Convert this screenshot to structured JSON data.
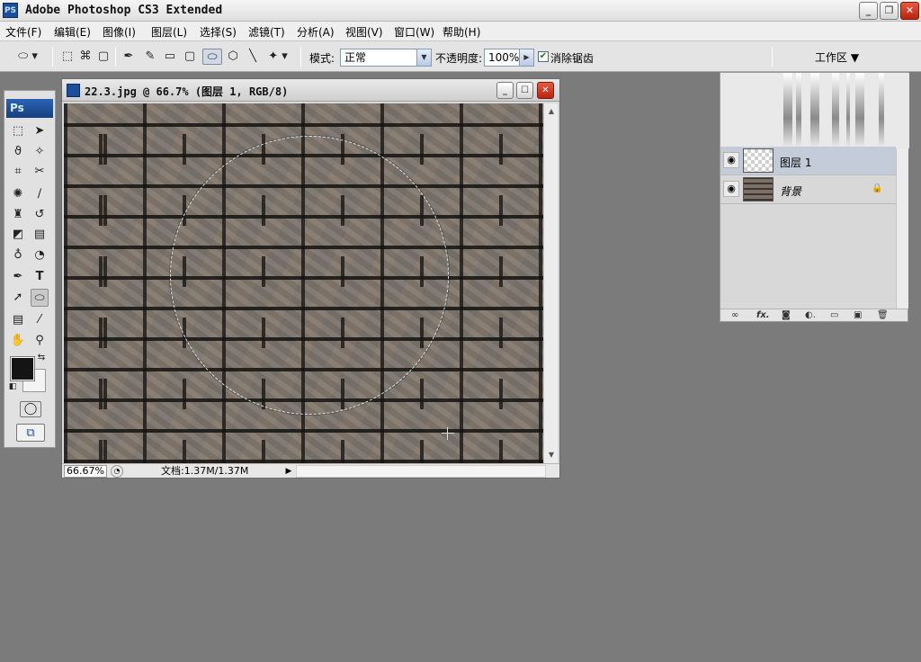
{
  "titlebar": {
    "app_icon": "PS",
    "title": "Adobe Photoshop CS3 Extended",
    "minimize": "_",
    "restore": "❐",
    "close": "✕"
  },
  "menubar": {
    "items": [
      "文件(F)",
      "编辑(E)",
      "图像(I)",
      "图层(L)",
      "选择(S)",
      "滤镜(T)",
      "分析(A)",
      "视图(V)",
      "窗口(W)",
      "帮助(H)"
    ]
  },
  "options": {
    "mode_label": "模式:",
    "mode_value": "正常",
    "opacity_label": "不透明度:",
    "opacity_value": "100%",
    "antialias_label": "消除锯齿",
    "antialias_checked": true,
    "icons": [
      "ellipse-tool-icon",
      "transform-icon",
      "rect-icon",
      "pen-icon",
      "freeform-pen-icon",
      "rectangle-shape-icon",
      "rounded-rect-icon",
      "ellipse-shape-icon",
      "polygon-icon",
      "line-icon",
      "custom-shape-icon"
    ]
  },
  "workspace": {
    "label": "工作区 ▼"
  },
  "tools": {
    "badge": "Ps",
    "items": [
      "marquee-tool-icon",
      "move-tool-icon",
      "lasso-tool-icon",
      "magic-wand-tool-icon",
      "crop-tool-icon",
      "slice-tool-icon",
      "healing-brush-tool-icon",
      "brush-tool-icon",
      "clone-stamp-tool-icon",
      "history-brush-tool-icon",
      "eraser-tool-icon",
      "gradient-tool-icon",
      "blur-tool-icon",
      "dodge-tool-icon",
      "pen-tool-icon",
      "type-tool-icon",
      "path-selection-tool-icon",
      "ellipse-shape-tool-icon",
      "notes-tool-icon",
      "eyedropper-tool-icon",
      "hand-tool-icon",
      "zoom-tool-icon"
    ],
    "foreground_color": "#141414",
    "background_color": "#f4f4f4"
  },
  "document": {
    "title": "22.3.jpg @ 66.7% (图层 1, RGB/8)",
    "zoom": "66.67%",
    "doc_info": "文档:1.37M/1.37M"
  },
  "layers": {
    "items": [
      {
        "name": "图层 1",
        "selected": true,
        "locked": false
      },
      {
        "name": "背景",
        "selected": false,
        "locked": true
      }
    ],
    "footer_icons": [
      "link-icon",
      "fx-icon",
      "mask-icon",
      "adjustment-icon",
      "group-icon",
      "new-layer-icon",
      "delete-icon"
    ],
    "footer_labels": [
      "∞",
      "fx.",
      "◙",
      "◐.",
      "▭",
      "▣",
      "🗑"
    ]
  }
}
